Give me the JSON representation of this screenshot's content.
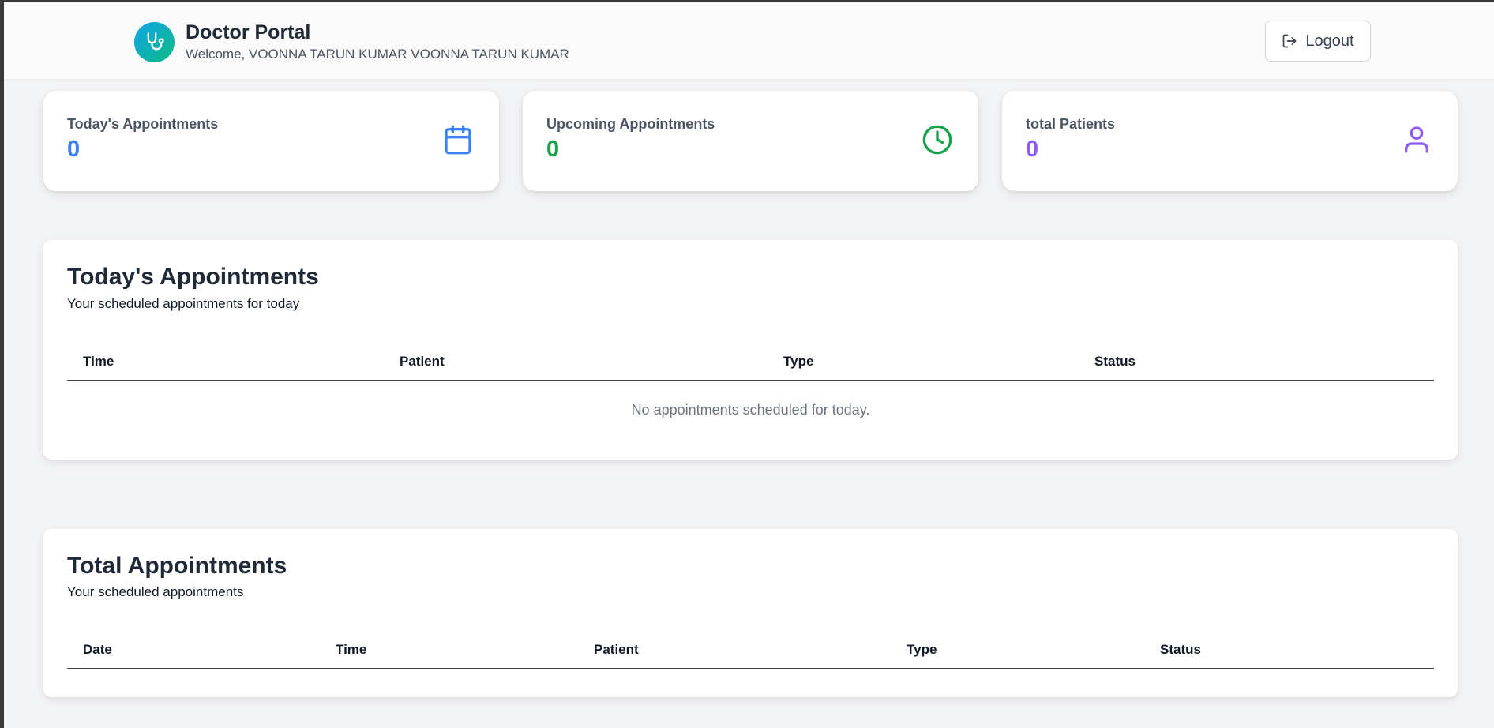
{
  "header": {
    "title": "Doctor Portal",
    "welcome": "Welcome, VOONNA TARUN KUMAR VOONNA TARUN KUMAR",
    "logout_label": "Logout",
    "logo_icon": "stethoscope-icon"
  },
  "stats": [
    {
      "label": "Today's Appointments",
      "value": "0",
      "color": "#3b82f6",
      "icon": "calendar-icon"
    },
    {
      "label": "Upcoming Appointments",
      "value": "0",
      "color": "#16a34a",
      "icon": "clock-icon"
    },
    {
      "label": "total Patients",
      "value": "0",
      "color": "#8b5cf6",
      "icon": "user-icon"
    }
  ],
  "today": {
    "title": "Today's Appointments",
    "subtitle": "Your scheduled appointments for today",
    "columns": [
      "Time",
      "Patient",
      "Type",
      "Status"
    ],
    "empty_message": "No appointments scheduled for today."
  },
  "total": {
    "title": "Total Appointments",
    "subtitle": "Your scheduled appointments",
    "columns": [
      "Date",
      "Time",
      "Patient",
      "Type",
      "Status"
    ]
  }
}
